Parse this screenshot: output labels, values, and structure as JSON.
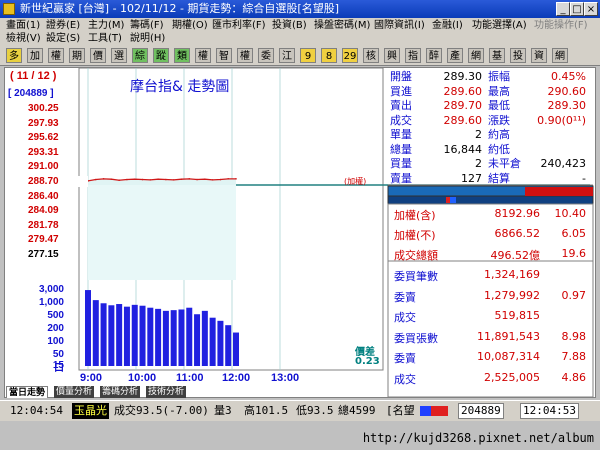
{
  "window": {
    "title": "新世紀贏家 [台灣] - 102/11/12 - 期貨走勢：綜合自選股[名望股]",
    "controls": [
      "_",
      "□",
      "×"
    ]
  },
  "menu": {
    "row1": [
      "畫面(1)",
      "證券(E)",
      "主力(M)",
      "籌碼(F)",
      "期權(O)",
      "匯市利率(F)",
      "投資(B)",
      "操盤密碼(M)",
      "國際資訊(I)",
      "金融(I)",
      "功能選擇(A)",
      "功能操作(F)"
    ],
    "row2": [
      "檢視(V)",
      "設定(S)",
      "工具(T)",
      "說明(H)"
    ]
  },
  "toolbar": {
    "buttons": [
      "多",
      "加",
      "權",
      "期",
      "價",
      "選",
      "綜",
      "蹤",
      "類",
      "權",
      "智",
      "權",
      "委",
      "江",
      "9",
      "8",
      "29",
      "核",
      "興",
      "指",
      "醉",
      "產",
      "網",
      "基",
      "投",
      "資",
      "網"
    ]
  },
  "chart": {
    "date_label": "( 11 / 12 )",
    "title": "摩台指& 走勢圖",
    "volume_readout": "[ 204889 ]",
    "index_marker": "(加權)",
    "price_spread_label": "價差",
    "price_spread_value": "0.23",
    "volume_unit": "口",
    "price_ticks": [
      "300.25",
      "297.93",
      "295.62",
      "293.31",
      "291.00",
      "288.70",
      "286.40",
      "284.09",
      "281.78",
      "279.47",
      "277.15"
    ],
    "volume_ticks": [
      "3,000",
      "1,000",
      "500",
      "200",
      "100",
      "50",
      "15"
    ],
    "time_ticks": [
      "9:00",
      "10:00",
      "11:00",
      "12:00",
      "13:00"
    ]
  },
  "chart_data": {
    "type": "line",
    "title": "摩台指& 走勢圖",
    "xlabel": "",
    "ylabel": "",
    "x": [
      "9:00",
      "9:10",
      "9:20",
      "9:30",
      "9:40",
      "9:50",
      "10:00",
      "10:10",
      "10:20",
      "10:30",
      "10:40",
      "10:50",
      "11:00",
      "11:10",
      "11:20",
      "11:30",
      "11:40",
      "11:50",
      "12:00",
      "12:04"
    ],
    "series": [
      {
        "values": [
          289.3,
          289.5,
          289.6,
          289.55,
          289.4,
          289.5,
          289.55,
          289.5,
          289.45,
          289.55,
          289.5,
          289.45,
          289.55,
          289.6,
          289.5,
          289.55,
          289.45,
          289.5,
          289.6,
          289.6
        ]
      }
    ],
    "ylim": [
      277.15,
      300.25
    ],
    "reference_line": 288.7,
    "volume": [
      1000,
      400,
      300,
      250,
      280,
      220,
      260,
      240,
      200,
      180,
      150,
      160,
      170,
      200,
      110,
      150,
      80,
      60,
      40,
      20
    ]
  },
  "quote": {
    "rows": [
      {
        "l1": "開盤",
        "v1": "289.30",
        "c1": "black",
        "l2": "振幅",
        "v2": "0.45%",
        "c2": "red"
      },
      {
        "l1": "買進",
        "v1": "289.60",
        "c1": "red",
        "l2": "最高",
        "v2": "290.60",
        "c2": "red"
      },
      {
        "l1": "賣出",
        "v1": "289.70",
        "c1": "red",
        "l2": "最低",
        "v2": "289.30",
        "c2": "red"
      },
      {
        "l1": "成交",
        "v1": "289.60",
        "c1": "red",
        "l2": "漲跌",
        "v2": "0.90(0¹¹)",
        "c2": "red"
      },
      {
        "l1": "單量",
        "v1": "2",
        "c1": "black",
        "l2": "約高",
        "v2": "",
        "c2": "black"
      },
      {
        "l1": "總量",
        "v1": "16,844",
        "c1": "black",
        "l2": "約低",
        "v2": "",
        "c2": "black"
      },
      {
        "l1": "買量",
        "v1": "2",
        "c1": "black",
        "l2": "未平倉",
        "v2": "240,423",
        "c2": "black"
      },
      {
        "l1": "賣量",
        "v1": "127",
        "c1": "black",
        "l2": "結算",
        "v2": "-",
        "c2": "black"
      }
    ]
  },
  "stats": [
    {
      "label": "加權(含)",
      "value": "8192.96",
      "change": "10.40"
    },
    {
      "label": "加權(不)",
      "value": "6866.52",
      "change": "6.05"
    },
    {
      "label": "成交總額",
      "value": "496.52億",
      "change": "19.6"
    }
  ],
  "trades": [
    {
      "label": "委買筆數",
      "value": "1,324,169",
      "change": ""
    },
    {
      "label": "委賣",
      "value": "1,279,992",
      "change": "0.97"
    },
    {
      "label": "成交",
      "value": "519,815",
      "change": ""
    },
    {
      "label": "委買張數",
      "value": "11,891,543",
      "change": "8.98"
    },
    {
      "label": "委賣",
      "value": "10,087,314",
      "change": "7.88"
    },
    {
      "label": "成交",
      "value": "2,525,005",
      "change": "4.86"
    }
  ],
  "tabs": [
    "當日走勢",
    "價量分析",
    "籌碼分析",
    "技術分析"
  ],
  "status": {
    "time": "12:04:54",
    "name": "玉晶光",
    "trade": "成交93.5(-7.00)",
    "qty": "量3",
    "high": "高101.5",
    "low": "低93.5",
    "total": "總4599",
    "group": "[名望",
    "volume": "204889",
    "clock": "12:04:53"
  },
  "footer": {
    "url": "http://kujd3268.pixnet.net/album"
  }
}
